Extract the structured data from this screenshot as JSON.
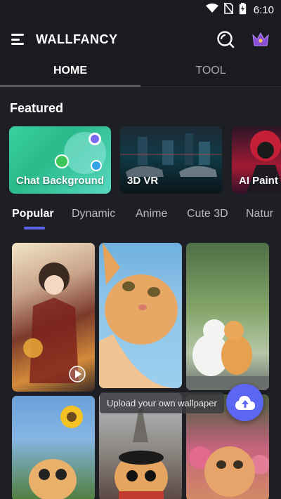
{
  "status_bar": {
    "time": "6:10",
    "icons": [
      "wifi-icon",
      "no-sim-icon",
      "battery-charging-icon"
    ]
  },
  "app_bar": {
    "title": "WALLFANCY",
    "icons": [
      "menu-icon",
      "search-icon",
      "crown-icon"
    ]
  },
  "tabs": [
    {
      "label": "HOME",
      "active": true
    },
    {
      "label": "TOOL",
      "active": false
    }
  ],
  "featured": {
    "title": "Featured",
    "cards": [
      {
        "label": "Chat Background"
      },
      {
        "label": "3D VR"
      },
      {
        "label": "AI Paint"
      }
    ]
  },
  "categories": [
    {
      "label": "Popular",
      "active": true
    },
    {
      "label": "Dynamic"
    },
    {
      "label": "Anime"
    },
    {
      "label": "Cute 3D"
    },
    {
      "label": "Natur"
    }
  ],
  "upload": {
    "hint": "Upload your own wallpaper"
  },
  "colors": {
    "accent": "#5b66f2",
    "background": "#1e1f24",
    "crown": "#8a4fd8"
  }
}
